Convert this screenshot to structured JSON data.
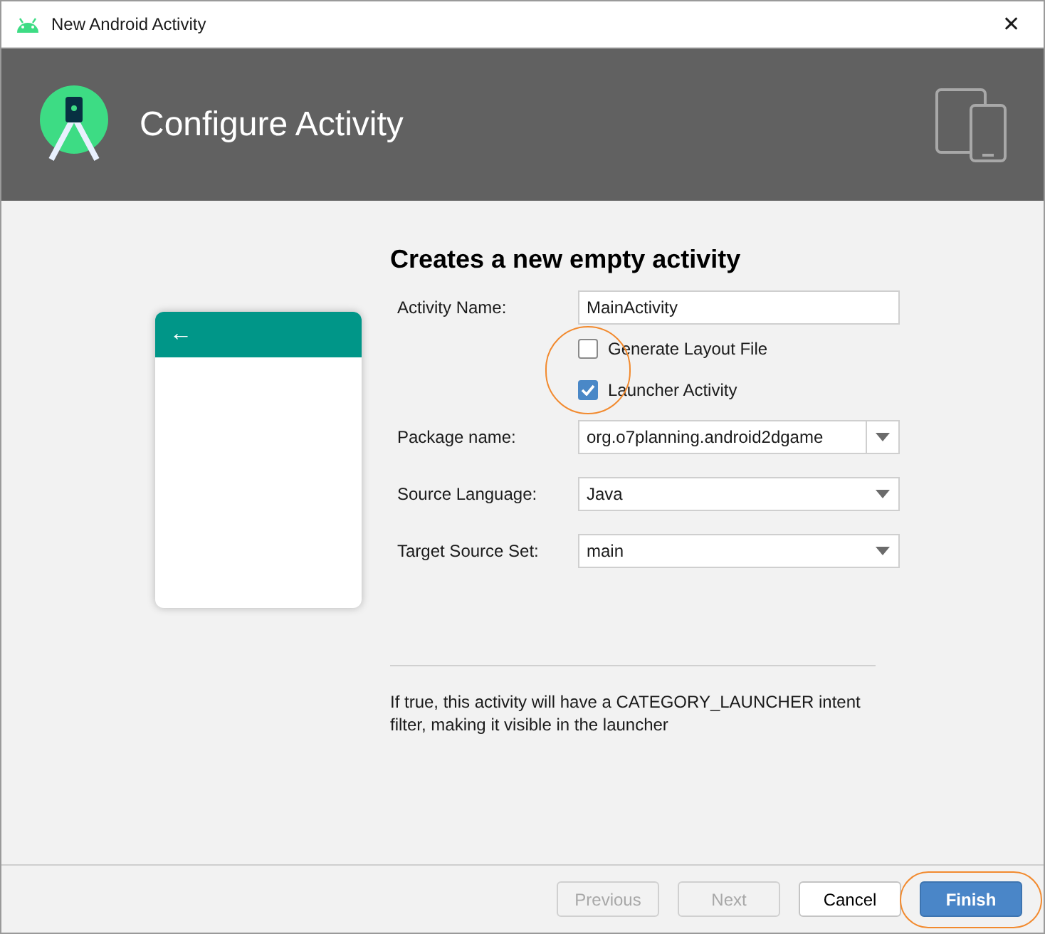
{
  "window": {
    "title": "New Android Activity",
    "close": "✕"
  },
  "header": {
    "title": "Configure Activity"
  },
  "preview": {
    "back": "←"
  },
  "form": {
    "heading": "Creates a new empty activity",
    "activity_name": {
      "label": "Activity Name:",
      "value": "MainActivity"
    },
    "checkboxes": [
      {
        "label": "Generate Layout File",
        "checked": false,
        "highlighted": false
      },
      {
        "label": "Launcher Activity",
        "checked": true,
        "highlighted": true
      }
    ],
    "selects": [
      {
        "label": "Package name:",
        "value": "org.o7planning.android2dgame",
        "kind": "combo"
      },
      {
        "label": "Source Language:",
        "value": "Java",
        "kind": "dropdown"
      },
      {
        "label": "Target Source Set:",
        "value": "main",
        "kind": "dropdown"
      }
    ],
    "description": "If true, this activity will have a CATEGORY_LAUNCHER intent filter, making it visible in the launcher"
  },
  "buttons": [
    {
      "label": "Previous",
      "disabled": true,
      "primary": false,
      "highlighted": false
    },
    {
      "label": "Next",
      "disabled": true,
      "primary": false,
      "highlighted": false
    },
    {
      "label": "Cancel",
      "disabled": false,
      "primary": false,
      "highlighted": false
    },
    {
      "label": "Finish",
      "disabled": false,
      "primary": true,
      "highlighted": true
    }
  ]
}
